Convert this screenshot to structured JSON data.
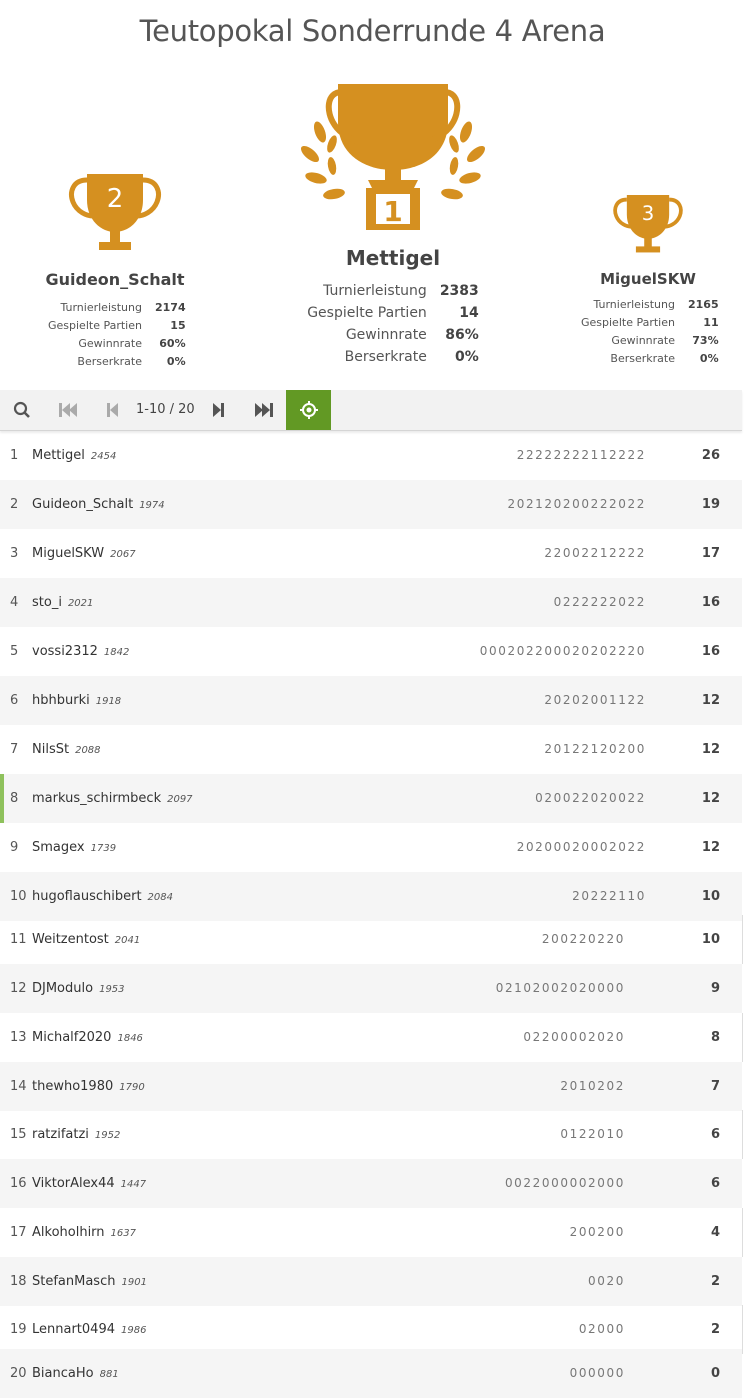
{
  "title": "Teutopokal Sonderrunde 4 Arena",
  "colors": {
    "trophy": "#d59020",
    "accent_green": "#629924",
    "me_marker": "#8ec15c"
  },
  "podium": {
    "first": {
      "rank": "1",
      "name": "Mettigel",
      "stats": [
        {
          "label": "Turnierleistung",
          "value": "2383"
        },
        {
          "label": "Gespielte Partien",
          "value": "14"
        },
        {
          "label": "Gewinnrate",
          "value": "86%"
        },
        {
          "label": "Berserkrate",
          "value": "0%"
        }
      ]
    },
    "second": {
      "rank": "2",
      "name": "Guideon_Schalt",
      "stats": [
        {
          "label": "Turnierleistung",
          "value": "2174"
        },
        {
          "label": "Gespielte Partien",
          "value": "15"
        },
        {
          "label": "Gewinnrate",
          "value": "60%"
        },
        {
          "label": "Berserkrate",
          "value": "0%"
        }
      ]
    },
    "third": {
      "rank": "3",
      "name": "MiguelSKW",
      "stats": [
        {
          "label": "Turnierleistung",
          "value": "2165"
        },
        {
          "label": "Gespielte Partien",
          "value": "11"
        },
        {
          "label": "Gewinnrate",
          "value": "73%"
        },
        {
          "label": "Berserkrate",
          "value": "0%"
        }
      ]
    }
  },
  "toolbar": {
    "icons": [
      "search-icon",
      "first-page-icon",
      "previous-page-icon",
      "next-page-icon",
      "last-page-icon",
      "locate-me-icon"
    ],
    "page_range": "1-10 / 20"
  },
  "standings": [
    {
      "rank": "1",
      "name": "Mettigel",
      "rating": "2454",
      "sheet": "22222222112222",
      "score": "26"
    },
    {
      "rank": "2",
      "name": "Guideon_Schalt",
      "rating": "1974",
      "sheet": "202120200222022",
      "score": "19"
    },
    {
      "rank": "3",
      "name": "MiguelSKW",
      "rating": "2067",
      "sheet": "22002212222",
      "score": "17"
    },
    {
      "rank": "4",
      "name": "sto_i",
      "rating": "2021",
      "sheet": "0222222022",
      "score": "16"
    },
    {
      "rank": "5",
      "name": "vossi2312",
      "rating": "1842",
      "sheet": "000202200020202220",
      "score": "16"
    },
    {
      "rank": "6",
      "name": "hbhburki",
      "rating": "1918",
      "sheet": "20202001122",
      "score": "12"
    },
    {
      "rank": "7",
      "name": "NilsSt",
      "rating": "2088",
      "sheet": "20122120200",
      "score": "12"
    },
    {
      "rank": "8",
      "name": "markus_schirmbeck",
      "rating": "2097",
      "sheet": "020022020022",
      "score": "12"
    },
    {
      "rank": "9",
      "name": "Smagex",
      "rating": "1739",
      "sheet": "20200020002022",
      "score": "12"
    },
    {
      "rank": "10",
      "name": "hugoflauschibert",
      "rating": "2084",
      "sheet": "20222110",
      "score": "10"
    },
    {
      "rank": "11",
      "name": "Weitzentost",
      "rating": "2041",
      "sheet": "200220220",
      "score": "10"
    },
    {
      "rank": "12",
      "name": "DJModulo",
      "rating": "1953",
      "sheet": "02102002020000",
      "score": "9"
    },
    {
      "rank": "13",
      "name": "Michalf2020",
      "rating": "1846",
      "sheet": "02200002020",
      "score": "8"
    },
    {
      "rank": "14",
      "name": "thewho1980",
      "rating": "1790",
      "sheet": "2010202",
      "score": "7"
    },
    {
      "rank": "15",
      "name": "ratzifatzi",
      "rating": "1952",
      "sheet": "0122010",
      "score": "6"
    },
    {
      "rank": "16",
      "name": "ViktorAlex44",
      "rating": "1447",
      "sheet": "0022000002000",
      "score": "6"
    },
    {
      "rank": "17",
      "name": "Alkoholhirn",
      "rating": "1637",
      "sheet": "200200",
      "score": "4"
    },
    {
      "rank": "18",
      "name": "StefanMasch",
      "rating": "1901",
      "sheet": "0020",
      "score": "2"
    },
    {
      "rank": "19",
      "name": "Lennart0494",
      "rating": "1986",
      "sheet": "02000",
      "score": "2"
    },
    {
      "rank": "20",
      "name": "BiancaHo",
      "rating": "881",
      "sheet": "000000",
      "score": "0"
    }
  ]
}
